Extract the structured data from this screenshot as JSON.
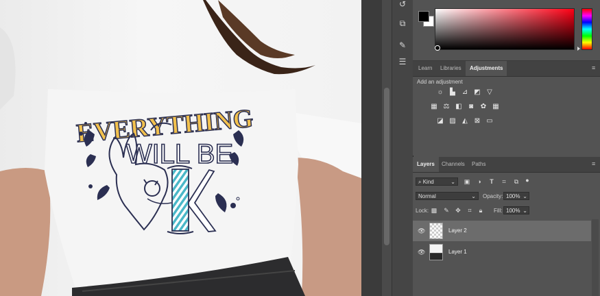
{
  "canvas": {
    "artwork_text_line1": "EVERYTHING",
    "artwork_text_line2": "WILL BE",
    "artwork_text_line3": "K"
  },
  "colors": {
    "foreground": "#000000",
    "background": "#ffffff",
    "artwork_navy": "#2b2f52",
    "artwork_yellow": "#f2c14e",
    "artwork_teal": "#4ab8c8",
    "panel_bg": "#535353",
    "tab_bar_bg": "#424242",
    "selected_layer": "#6c6c6c"
  },
  "tools": [
    "history-icon",
    "3d-cube-icon",
    "brush-settings-icon",
    "properties-sliders-icon"
  ],
  "adjustments_panel": {
    "tabs": [
      {
        "label": "Learn",
        "active": false
      },
      {
        "label": "Libraries",
        "active": false
      },
      {
        "label": "Adjustments",
        "active": true
      }
    ],
    "add_label": "Add an adjustment",
    "icons_row1": [
      "brightness-contrast-icon",
      "levels-icon",
      "curves-icon",
      "exposure-icon",
      "vibrance-icon"
    ],
    "icons_row2": [
      "hue-saturation-icon",
      "color-balance-icon",
      "black-white-icon",
      "photo-filter-icon",
      "channel-mixer-icon",
      "color-lookup-icon"
    ],
    "icons_row3": [
      "invert-icon",
      "posterize-icon",
      "threshold-icon",
      "selective-color-icon",
      "gradient-map-icon"
    ]
  },
  "layers_panel": {
    "tabs": [
      {
        "label": "Layers",
        "active": true
      },
      {
        "label": "Channels",
        "active": false
      },
      {
        "label": "Paths",
        "active": false
      }
    ],
    "filter_kind": "Kind",
    "blend_mode": "Normal",
    "opacity_label": "Opacity:",
    "opacity_value": "100%",
    "lock_label": "Lock:",
    "fill_label": "Fill:",
    "fill_value": "100%",
    "layers": [
      {
        "name": "Layer 2",
        "selected": true,
        "visible": true,
        "thumbnail": "transparent"
      },
      {
        "name": "Layer 1",
        "selected": false,
        "visible": true,
        "thumbnail": "photo"
      }
    ]
  }
}
